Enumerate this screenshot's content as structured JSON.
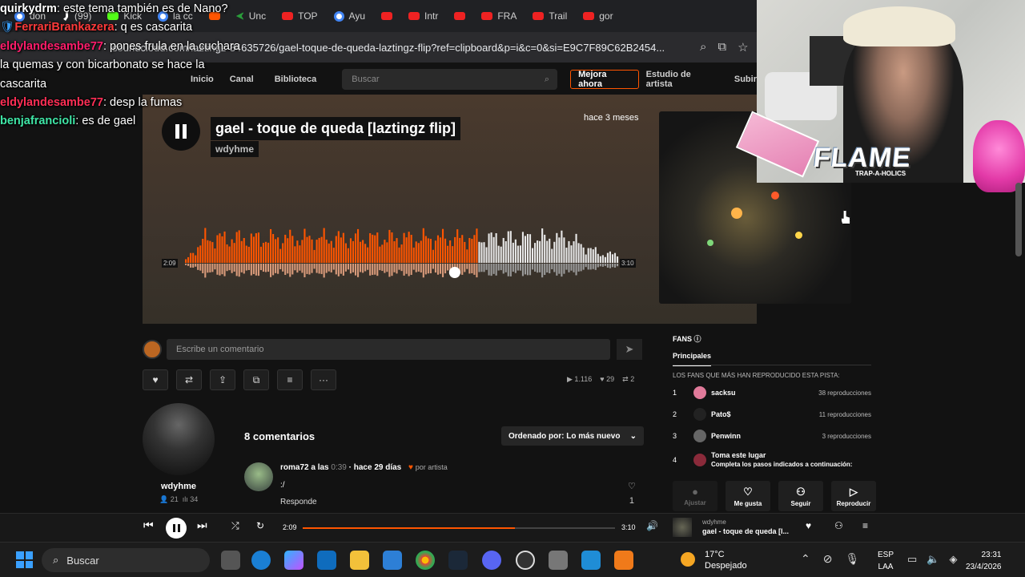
{
  "browser": {
    "tabs": [
      {
        "label": "don",
        "icon": "google-icon"
      },
      {
        "label": "(99)",
        "icon": "tiktok-icon"
      },
      {
        "label": "Kick",
        "icon": "kick-icon"
      },
      {
        "label": "la cc",
        "icon": "google-icon"
      },
      {
        "label": "",
        "icon": "soundcloud-icon"
      },
      {
        "label": "Unc",
        "icon": "shortcut-icon"
      },
      {
        "label": "TOP",
        "icon": "youtube-icon"
      },
      {
        "label": "Ayu",
        "icon": "google-icon"
      },
      {
        "label": "",
        "icon": "youtube-icon"
      },
      {
        "label": "Intr",
        "icon": "youtube-icon"
      },
      {
        "label": "",
        "icon": "youtube-icon"
      },
      {
        "label": "FRA",
        "icon": "youtube-icon"
      },
      {
        "label": "Trail",
        "icon": "youtube-icon"
      },
      {
        "label": "gor",
        "icon": "youtube-icon"
      }
    ],
    "url": "soundcloud.com/laztingz-84635726/gael-toque-de-queda-laztingz-flip?ref=clipboard&p=i&c=0&si=E9C7F89C62B2454..."
  },
  "sc_header": {
    "nav_home": "Inicio",
    "nav_feed": "Canal",
    "nav_library": "Biblioteca",
    "search_placeholder": "Buscar",
    "upgrade": "Mejora ahora",
    "artist_studio": "Estudio de artista",
    "upload": "Subir"
  },
  "track": {
    "title": "gael - toque de queda [laztingz flip]",
    "artist": "wdyhme",
    "uploaded": "hace 3 meses",
    "time_current": "2:09",
    "time_total": "3:10",
    "progress": 0.68
  },
  "comment_box": {
    "placeholder": "Escribe un comentario"
  },
  "stats": {
    "plays": "1.116",
    "likes": "29",
    "reposts": "2"
  },
  "uploader": {
    "name": "wdyhme",
    "followers": "21",
    "tracks": "34"
  },
  "comments": {
    "count_label": "8 comentarios",
    "sort_label": "Ordenado por: Lo más nuevo",
    "items": [
      {
        "user": "roma72 a las",
        "time": "0:39",
        "ago": "· hace 29 días",
        "badge": "por artista",
        "text": ":/",
        "reply": "Responde",
        "likes": "1"
      }
    ]
  },
  "fans": {
    "header": "FANS",
    "tab": "Principales",
    "subtitle": "LOS FANS QUE MÁS HAN REPRODUCIDO ESTA PISTA:",
    "list": [
      {
        "rank": "1",
        "name": "sacksu",
        "plays": "38 reproducciones"
      },
      {
        "rank": "2",
        "name": "Pato$",
        "plays": "11 reproducciones"
      },
      {
        "rank": "3",
        "name": "Penwinn",
        "plays": "3 reproducciones"
      },
      {
        "rank": "4",
        "name": "Toma este lugar",
        "plays": "Completa los pasos indicados a continuación:"
      }
    ],
    "buttons": {
      "sign": "Ajustar",
      "like": "Me gusta",
      "follow": "Seguir",
      "play": "Reproducir"
    }
  },
  "player": {
    "current": "2:09",
    "total": "3:10",
    "artist": "wdyhme",
    "title": "gael - toque de queda [l...",
    "progress": 0.68
  },
  "taskbar": {
    "search": "Buscar",
    "weather_temp": "17°C",
    "weather_desc": "Despejado",
    "lang1": "ESP",
    "lang2": "LAA",
    "time": "23:31",
    "date": "23/4/2026"
  },
  "chat": [
    {
      "user": "quirkydrm",
      "text": ": este tema también es de Nano?"
    },
    {
      "user": "FerrariBrankazera",
      "text": ": q es cascarita"
    },
    {
      "user": "eldylandesambe77",
      "text": ": pones frula en la cuchara la quemas y con bicarbonato se hace la cascarita"
    },
    {
      "user": "eldylandesambe77",
      "text": ": desp la fumas"
    },
    {
      "user": "benjafrancioli",
      "text": ": es de gael"
    }
  ],
  "overlay": {
    "brand": "FLAME",
    "brand_sub": "TRAP-A-HOLICS"
  },
  "colors": {
    "accent": "#ff5500",
    "background": "#121212"
  }
}
